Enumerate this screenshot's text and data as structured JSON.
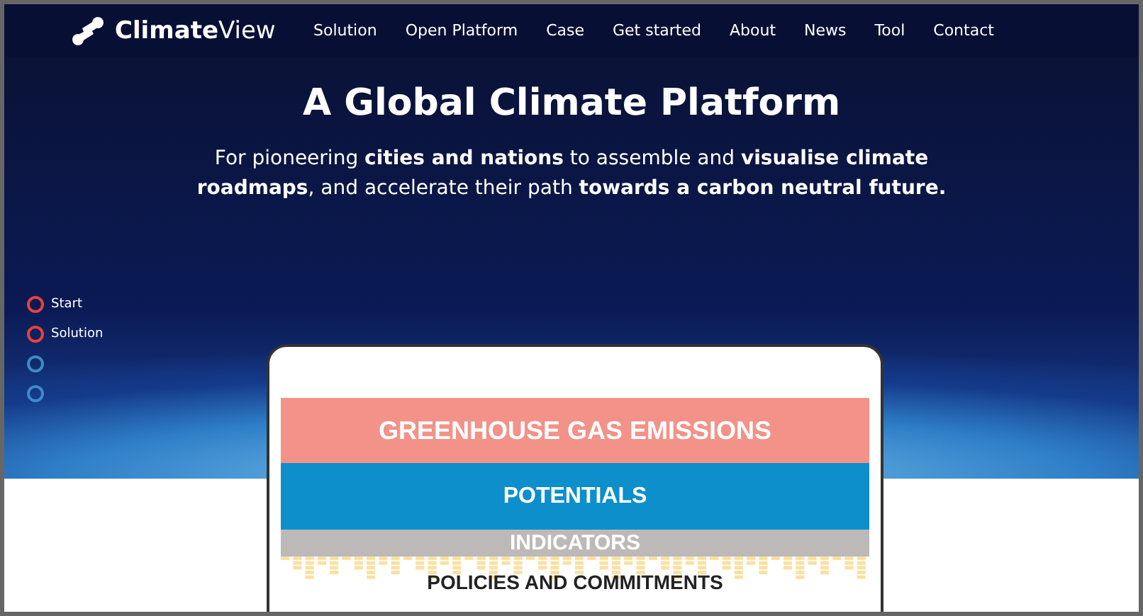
{
  "brand": {
    "name_part_1": "Climate",
    "name_part_2": "View"
  },
  "nav": [
    "Solution",
    "Open Platform",
    "Case",
    "Get started",
    "About",
    "News",
    "Tool",
    "Contact"
  ],
  "hero": {
    "title": "A Global Climate Platform",
    "subtitle": "For pioneering **cities and nations** to assemble and **visualise climate roadmaps**, and accelerate their path **towards a carbon neutral future.**"
  },
  "side_nav": [
    {
      "label": "Start",
      "color": "#e8413c"
    },
    {
      "label": "Solution",
      "color": "#e8413c"
    },
    {
      "color": "#3d8cc6"
    },
    {
      "color": "#3d8cc6"
    }
  ],
  "mockup": {
    "layers": [
      {
        "label": "GREENHOUSE GAS EMISSIONS",
        "kind": "emissions"
      },
      {
        "label": "POTENTIALS",
        "kind": "potentials"
      },
      {
        "label": "INDICATORS",
        "kind": "indicators"
      },
      {
        "label": "POLICIES AND COMMITMENTS",
        "kind": "policies"
      }
    ]
  }
}
